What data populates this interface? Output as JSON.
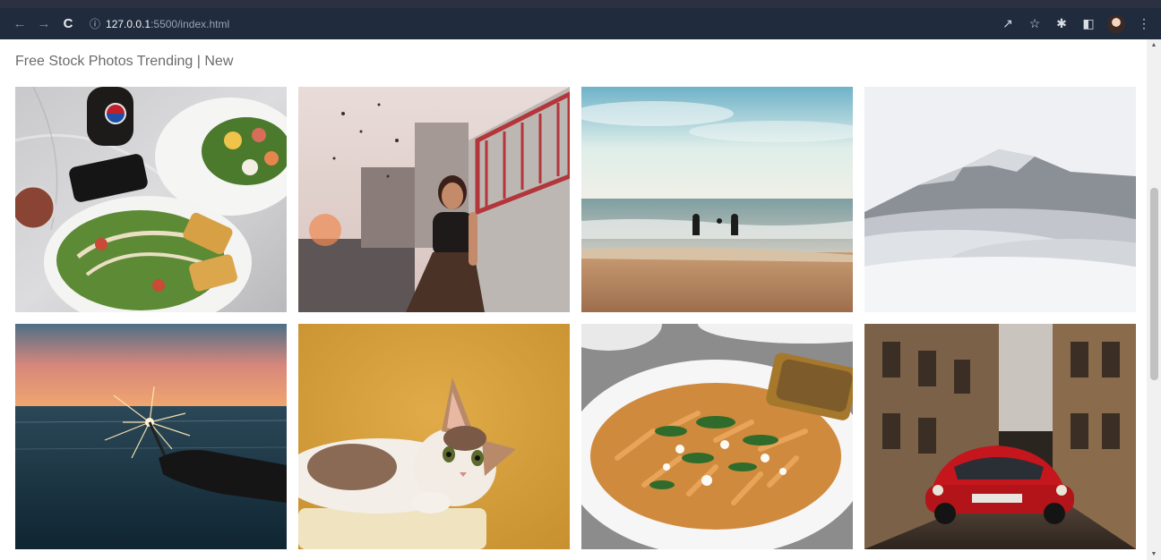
{
  "browser": {
    "url_host": "127.0.0.1",
    "url_path": ":5500/index.html",
    "icons": [
      "back-arrow-icon",
      "forward-arrow-icon",
      "reload-icon",
      "info-icon",
      "share-icon",
      "star-icon",
      "puzzle-icon",
      "sidepanel-icon",
      "avatar",
      "menu-icon"
    ]
  },
  "page": {
    "title": "Free Stock Photos Trending | New"
  },
  "photos": [
    {
      "subject": "salad-plates-on-marble"
    },
    {
      "subject": "smiling-woman-against-wall"
    },
    {
      "subject": "people-running-into-sea"
    },
    {
      "subject": "snowy-mountain-above-clouds"
    },
    {
      "subject": "sparkler-at-sunset-sea"
    },
    {
      "subject": "kitten-on-yellow-background"
    },
    {
      "subject": "pasta-with-greens"
    },
    {
      "subject": "red-beetle-on-old-street"
    }
  ],
  "colors": {
    "chrome_bg": "#202b3d",
    "title_text": "#6b6b6b"
  }
}
